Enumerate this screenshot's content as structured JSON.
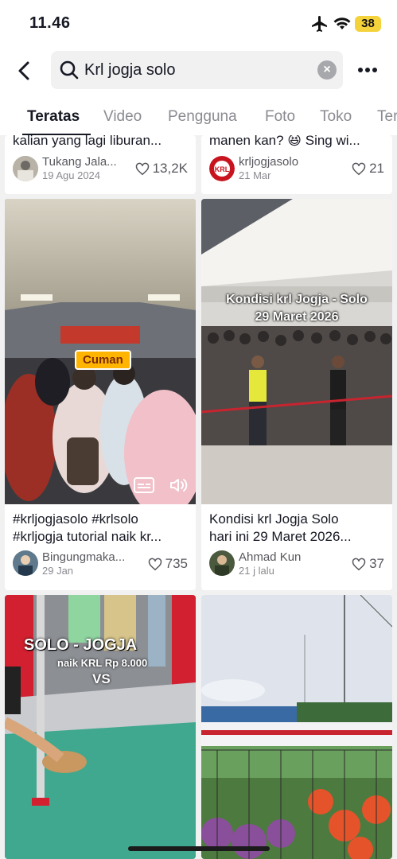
{
  "status_bar": {
    "time": "11.46",
    "battery": "38"
  },
  "search": {
    "query": "Krl jogja solo"
  },
  "tabs": [
    {
      "label": "Teratas",
      "active": true
    },
    {
      "label": "Video"
    },
    {
      "label": "Pengguna"
    },
    {
      "label": "Foto"
    },
    {
      "label": "Toko"
    },
    {
      "label": "Ter"
    }
  ],
  "top_row": [
    {
      "caption": "kalian yang lagi liburan...",
      "author": "Tukang Jala...",
      "date": "19 Agu 2024",
      "likes": "13,2K"
    },
    {
      "caption": "manen kan? 😆 Sing wi...",
      "author": "krljogjasolo",
      "date": "21 Mar",
      "likes": "21"
    }
  ],
  "mid_row": [
    {
      "caption_line1": "#krljogjasolo #krlsolo",
      "caption_line2": "#krljogja tutorial naik kr...",
      "author": "Bingungmaka...",
      "date": "29 Jan",
      "likes": "735",
      "overlay": "Cuman"
    },
    {
      "caption_line1": "Kondisi krl Jogja Solo",
      "caption_line2": "hari ini 29 Maret 2026...",
      "author": "Ahmad Kun",
      "date": "21 j lalu",
      "likes": "37",
      "overlay_line1": "Kondisi krl Jogja - Solo",
      "overlay_line2": "29 Maret 2026"
    }
  ],
  "bottom_row": [
    {
      "overlay_title": "SOLO - JOGJA",
      "overlay_sub": "naik KRL Rp 8.000",
      "overlay_vs": "VS"
    },
    {}
  ]
}
